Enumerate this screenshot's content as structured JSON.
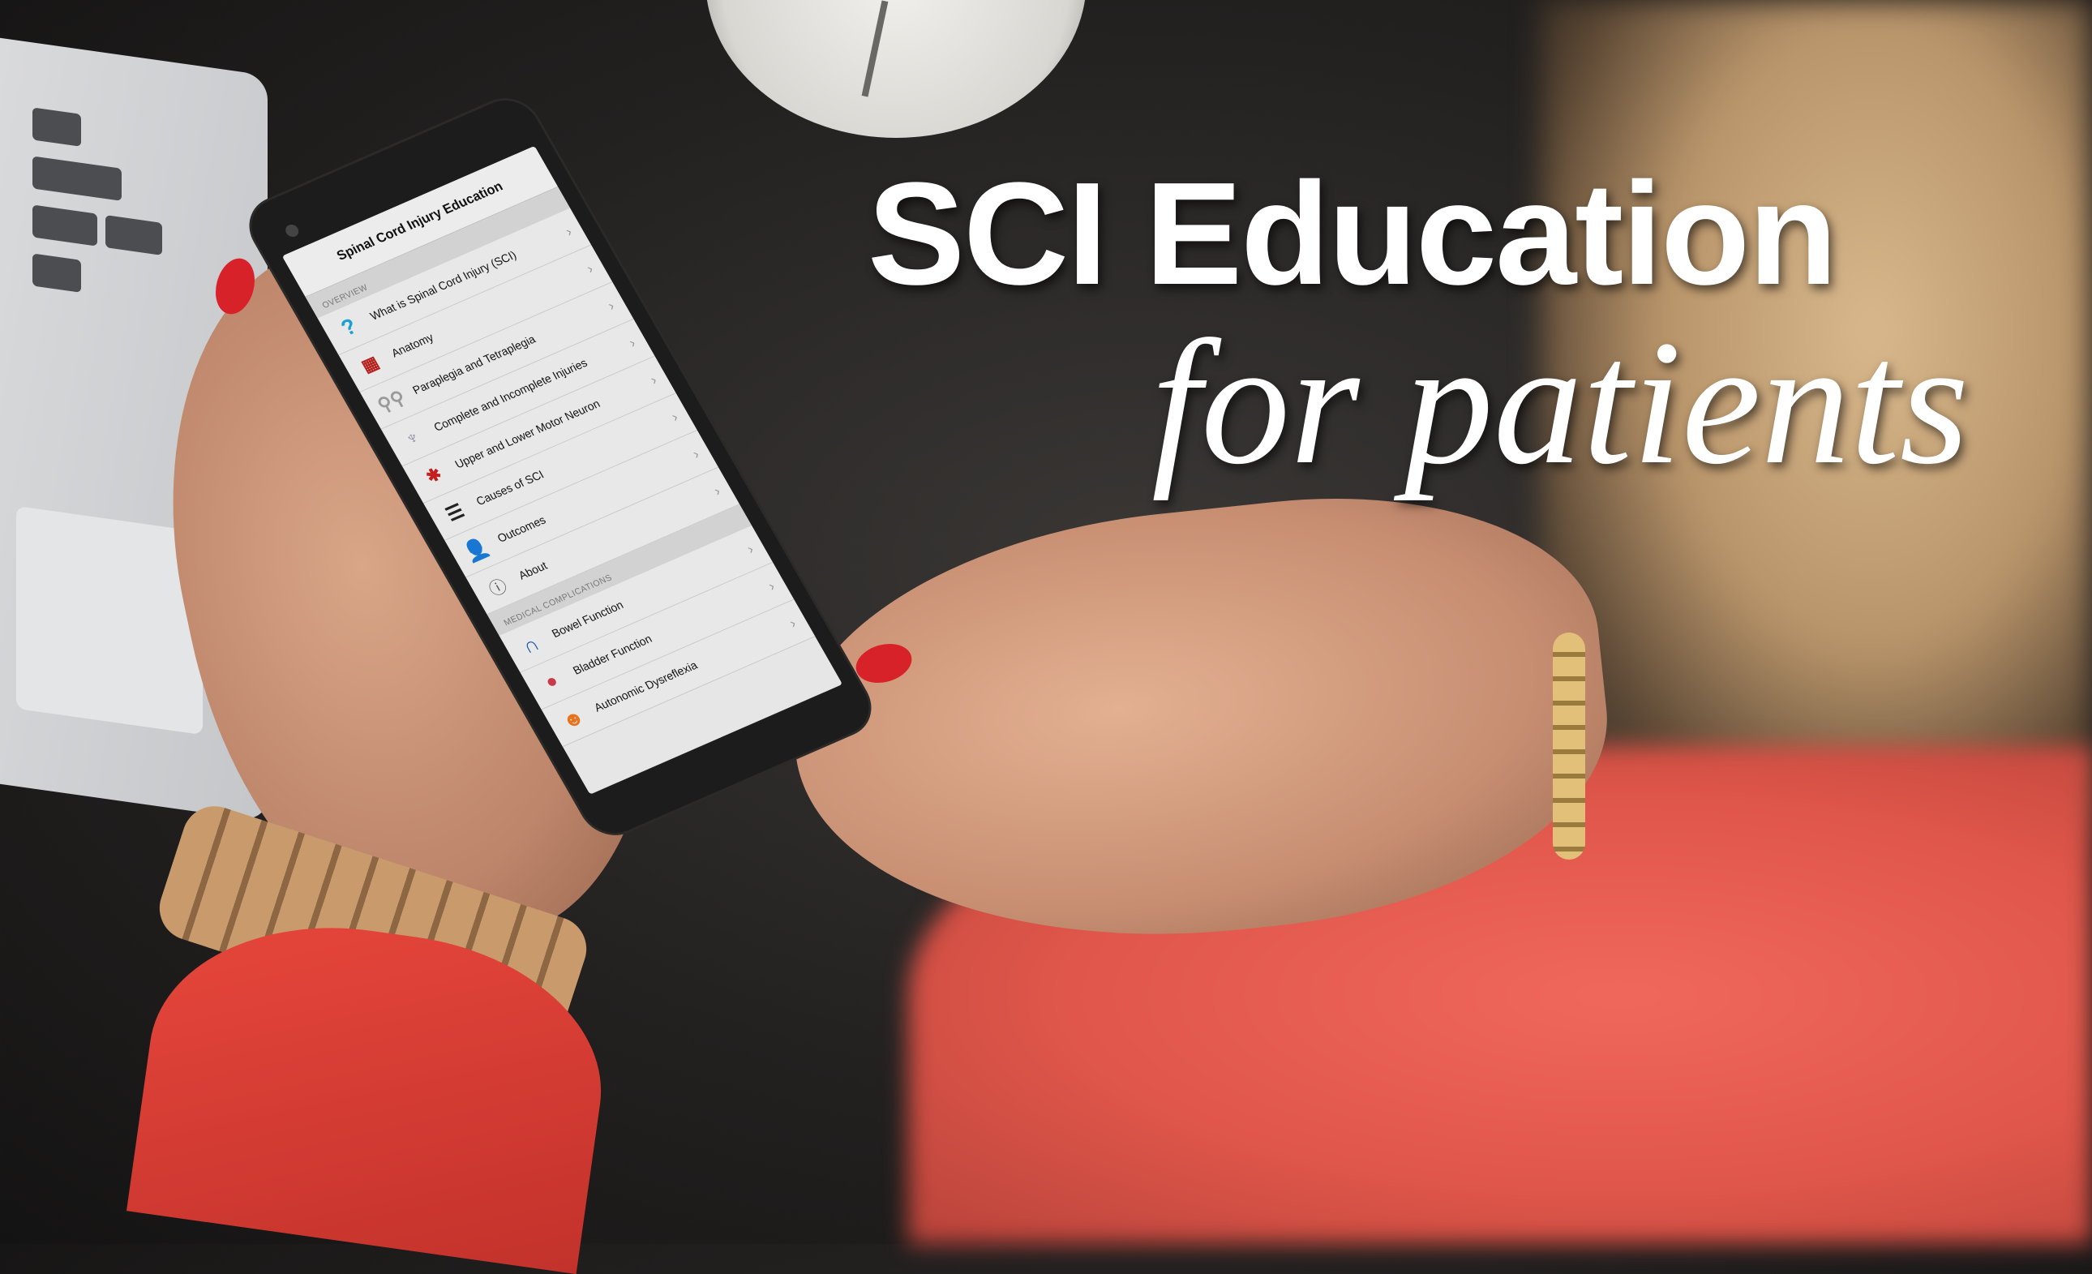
{
  "headline": {
    "title": "SCI Education",
    "subtitle": "for patients"
  },
  "app": {
    "title": "Spinal Cord Injury Education",
    "sections": [
      {
        "header": "OVERVIEW",
        "items": [
          {
            "label": "What is Spinal Cord Injury (SCI)",
            "icon": "question-icon"
          },
          {
            "label": "Anatomy",
            "icon": "spine-icon"
          },
          {
            "label": "Paraplegia and Tetraplegia",
            "icon": "body-figures-icon"
          },
          {
            "label": "Complete and Incomplete Injuries",
            "icon": "nerves-icon"
          },
          {
            "label": "Upper and Lower Motor Neuron",
            "icon": "neuron-icon"
          },
          {
            "label": "Causes of SCI",
            "icon": "list-icon"
          },
          {
            "label": "Outcomes",
            "icon": "person-icon"
          },
          {
            "label": "About",
            "icon": "info-icon"
          }
        ]
      },
      {
        "header": "MEDICAL COMPLICATIONS",
        "items": [
          {
            "label": "Bowel Function",
            "icon": "bowel-icon"
          },
          {
            "label": "Bladder Function",
            "icon": "bladder-icon"
          },
          {
            "label": "Autonomic Dysreflexia",
            "icon": "dysreflexia-icon"
          }
        ]
      }
    ]
  },
  "colors": {
    "nail": "#d8222a",
    "sleeve": "#e8473c",
    "question": "#1a9fd6"
  }
}
